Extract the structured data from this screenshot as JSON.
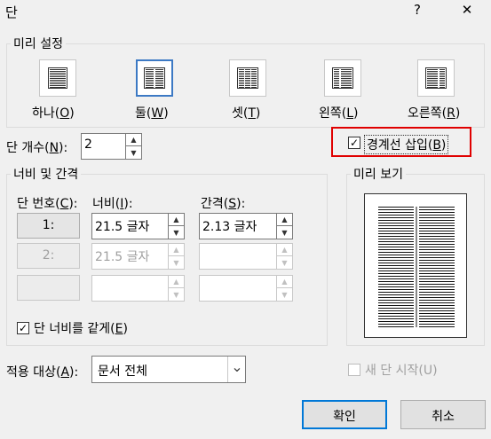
{
  "window": {
    "title": "단",
    "help_glyph": "?",
    "close_glyph": "✕"
  },
  "presets": {
    "label": "미리 설정",
    "items": [
      {
        "label_base": "하나(",
        "key": "O",
        "label_end": ")"
      },
      {
        "label_base": "둘(",
        "key": "W",
        "label_end": ")"
      },
      {
        "label_base": "셋(",
        "key": "T",
        "label_end": ")"
      },
      {
        "label_base": "왼쪽(",
        "key": "L",
        "label_end": ")"
      },
      {
        "label_base": "오른쪽(",
        "key": "R",
        "label_end": ")"
      }
    ],
    "selected_index": 1
  },
  "column_count": {
    "label_base": "단 개수(",
    "key": "N",
    "label_end": "):",
    "value": "2"
  },
  "line_between": {
    "label_base": "경계선 삽입(",
    "key": "B",
    "label_end": ")",
    "checked": true,
    "check_glyph": "✓"
  },
  "width_spacing": {
    "label": "너비 및 간격",
    "col_header_base": "단 번호(",
    "col_header_key": "C",
    "col_header_end": "):",
    "width_header_base": "너비(",
    "width_header_key": "I",
    "width_header_end": "):",
    "spacing_header_base": "간격(",
    "spacing_header_key": "S",
    "spacing_header_end": "):",
    "rows": [
      {
        "col": "1:",
        "width": "21.5 글자",
        "spacing": "2.13 글자",
        "enabled": true
      },
      {
        "col": "2:",
        "width": "21.5 글자",
        "spacing": "",
        "enabled": false
      },
      {
        "col": "",
        "width": "",
        "spacing": "",
        "enabled": false
      }
    ],
    "equal_width": {
      "label_base": "단 너비를 같게(",
      "key": "E",
      "label_end": ")",
      "checked": true,
      "check_glyph": "✓"
    }
  },
  "preview": {
    "label": "미리 보기",
    "columns": 2,
    "show_separator": true
  },
  "apply_to": {
    "label_base": "적용 대상(",
    "key": "A",
    "label_end": "):",
    "value": "문서 전체",
    "arrow_glyph": "⌄"
  },
  "new_column": {
    "label": "새 단 시작(U)",
    "checked": false,
    "enabled": false
  },
  "buttons": {
    "ok": "확인",
    "cancel": "취소"
  },
  "spinner_glyphs": {
    "up": "▲",
    "down": "▼"
  },
  "colors": {
    "highlight": "#e00000",
    "accent": "#0078d7",
    "selected_preset": "#3c79c4"
  }
}
